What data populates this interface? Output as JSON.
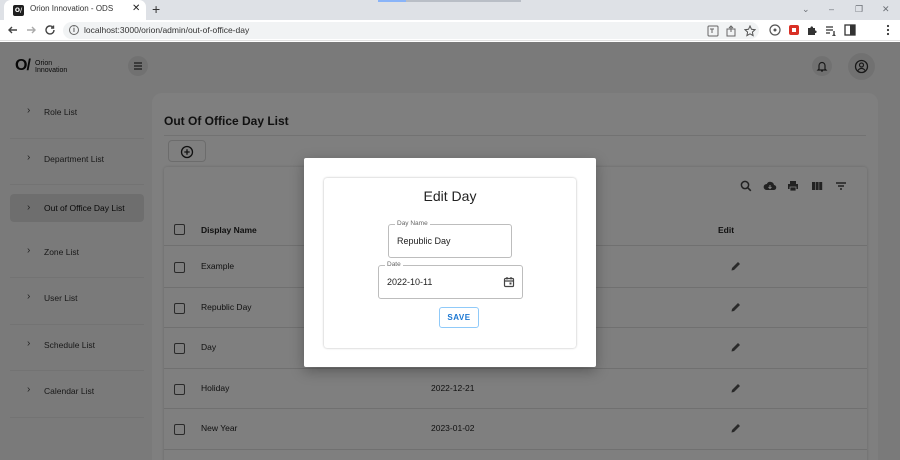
{
  "browser": {
    "tab_title": "Orion Innovation - ODS",
    "favicon_text": "O/",
    "tab_close": "✕",
    "new_tab": "+",
    "url": "localhost:3000/orion/admin/out-of-office-day",
    "profile_initial": "D",
    "window_controls": [
      "⌄",
      "–",
      "❐",
      "✕"
    ]
  },
  "app": {
    "logo_mark": "O/",
    "logo_text_line1": "Orion",
    "logo_text_line2": "Innovation",
    "sidebar": {
      "items": [
        {
          "label": "Role List",
          "active": false
        },
        {
          "label": "Department List",
          "active": false
        },
        {
          "label": "Out of Office Day List",
          "active": true
        },
        {
          "label": "Zone List",
          "active": false
        },
        {
          "label": "User List",
          "active": false
        },
        {
          "label": "Schedule List",
          "active": false
        },
        {
          "label": "Calendar List",
          "active": false
        }
      ]
    },
    "page_title": "Out Of Office Day List",
    "table": {
      "columns": {
        "display_name": "Display Name",
        "edit": "Edit"
      },
      "rows": [
        {
          "name": "Example",
          "date": ""
        },
        {
          "name": "Republic Day",
          "date": ""
        },
        {
          "name": "Day",
          "date": ""
        },
        {
          "name": "Holiday",
          "date": "2022-12-21"
        },
        {
          "name": "New Year",
          "date": "2023-01-02"
        }
      ]
    }
  },
  "dialog": {
    "title": "Edit Day",
    "day_name_label": "Day Name",
    "day_name_value": "Republic Day",
    "date_label": "Date",
    "date_value": "2022-10-11",
    "save_label": "SAVE"
  },
  "colors": {
    "accent": "#1976d2",
    "overlay": "rgba(0,0,0,0.5)",
    "profile": "#1e8e3e"
  }
}
